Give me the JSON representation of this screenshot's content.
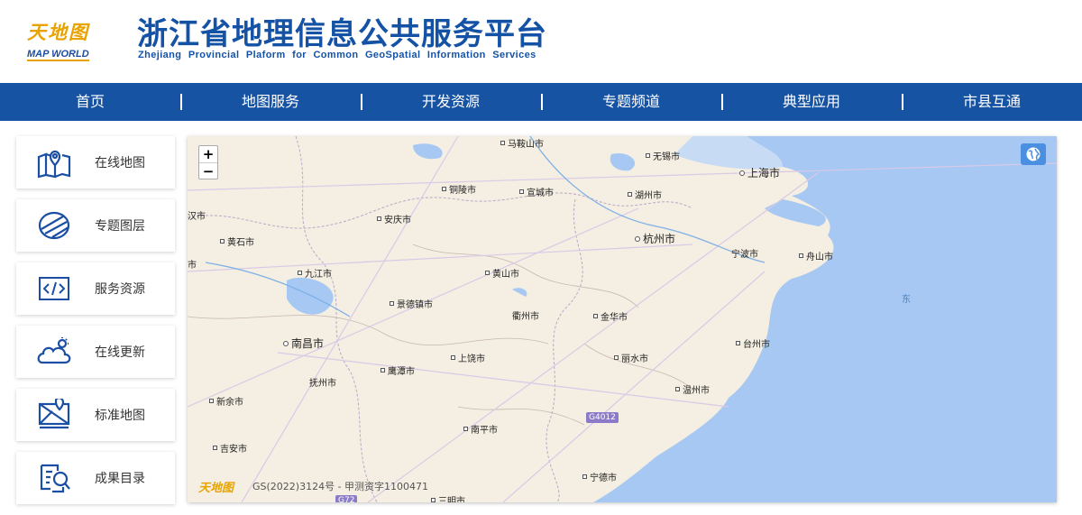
{
  "header": {
    "logo_cn": "天地图",
    "logo_en": "MAP WORLD",
    "title": "浙江省地理信息公共服务平台",
    "subtitle": "Zhejiang Provincial Plaform for Common GeoSpatial Information Services"
  },
  "nav": {
    "items": [
      {
        "label": "首页"
      },
      {
        "label": "地图服务"
      },
      {
        "label": "开发资源"
      },
      {
        "label": "专题频道"
      },
      {
        "label": "典型应用"
      },
      {
        "label": "市县互通"
      }
    ]
  },
  "sidebar": {
    "items": [
      {
        "label": "在线地图",
        "icon": "map-pin-icon"
      },
      {
        "label": "专题图层",
        "icon": "layer-icon"
      },
      {
        "label": "服务资源",
        "icon": "code-icon"
      },
      {
        "label": "在线更新",
        "icon": "cloud-update-icon"
      },
      {
        "label": "标准地图",
        "icon": "standard-map-icon"
      },
      {
        "label": "成果目录",
        "icon": "catalog-search-icon"
      }
    ]
  },
  "map": {
    "zoom_in": "+",
    "zoom_out": "−",
    "attribution": "GS(2022)3124号 - 甲测资字1100471",
    "logo": "天地图",
    "sea_label": "东",
    "highway": "G4012",
    "highway2": "G72",
    "cities": [
      {
        "name": "马鞍山市"
      },
      {
        "name": "无锡市"
      },
      {
        "name": "上海市"
      },
      {
        "name": "铜陵市"
      },
      {
        "name": "宣城市"
      },
      {
        "name": "湖州市"
      },
      {
        "name": "汉市"
      },
      {
        "name": "安庆市"
      },
      {
        "name": "黄石市"
      },
      {
        "name": "杭州市"
      },
      {
        "name": "宁波市"
      },
      {
        "name": "舟山市"
      },
      {
        "name": "市"
      },
      {
        "name": "九江市"
      },
      {
        "name": "黄山市"
      },
      {
        "name": "景德镇市"
      },
      {
        "name": "衢州市"
      },
      {
        "name": "金华市"
      },
      {
        "name": "南昌市"
      },
      {
        "name": "台州市"
      },
      {
        "name": "上饶市"
      },
      {
        "name": "丽水市"
      },
      {
        "name": "抚州市"
      },
      {
        "name": "鹰潭市"
      },
      {
        "name": "温州市"
      },
      {
        "name": "新余市"
      },
      {
        "name": "南平市"
      },
      {
        "name": "吉安市"
      },
      {
        "name": "宁德市"
      },
      {
        "name": "三明市"
      }
    ]
  },
  "colors": {
    "brand_blue": "#1452a6",
    "nav_blue": "#1753a3",
    "logo_gold": "#e8a300",
    "sea": "#a6c8f2",
    "land": "#f4efe2"
  }
}
